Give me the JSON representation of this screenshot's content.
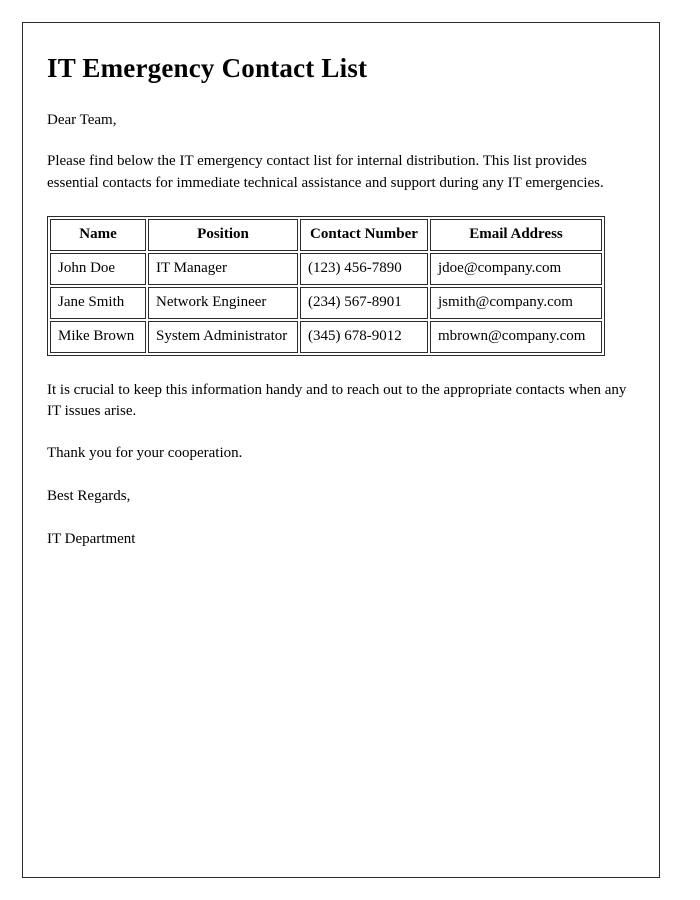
{
  "document": {
    "title": "IT Emergency Contact List",
    "salutation": "Dear Team,",
    "intro_paragraph": "Please find below the IT emergency contact list for internal distribution. This list provides essential contacts for immediate technical assistance and support during any IT emergencies.",
    "closing_paragraph": "It is crucial to keep this information handy and to reach out to the appropriate contacts when any IT issues arise.",
    "thanks_paragraph": "Thank you for your cooperation.",
    "sign_off": "Best Regards,",
    "signature": "IT Department"
  },
  "table": {
    "headers": {
      "name": "Name",
      "position": "Position",
      "contact_number": "Contact Number",
      "email_address": "Email Address"
    },
    "rows": [
      {
        "name": "John Doe",
        "position": "IT Manager",
        "contact_number": "(123) 456-7890",
        "email_address": "jdoe@company.com"
      },
      {
        "name": "Jane Smith",
        "position": "Network Engineer",
        "contact_number": "(234) 567-8901",
        "email_address": "jsmith@company.com"
      },
      {
        "name": "Mike Brown",
        "position": "System Administrator",
        "contact_number": "(345) 678-9012",
        "email_address": "mbrown@company.com"
      }
    ]
  },
  "colors": {
    "page_background": "#ffffff",
    "text": "#000000",
    "border": "#2b2b2b"
  }
}
